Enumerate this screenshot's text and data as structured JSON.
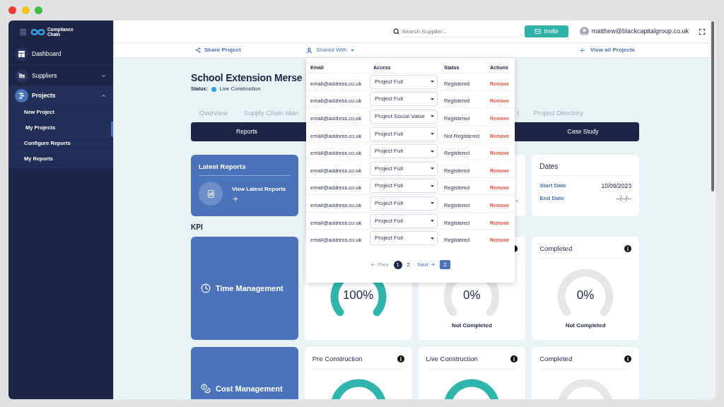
{
  "sidebar": {
    "logo_lines": [
      "Compliance",
      "Chain"
    ],
    "items": [
      {
        "label": "Dashboard",
        "kind": "link",
        "selected": false
      },
      {
        "label": "Suppliers",
        "kind": "group",
        "selected": false,
        "expanded": false
      },
      {
        "label": "Projects",
        "kind": "group",
        "selected": true,
        "expanded": true,
        "children": [
          {
            "label": "New Project",
            "selected": false
          },
          {
            "label": "My Projects",
            "selected": true
          },
          {
            "label": "Configure Reports",
            "selected": false
          },
          {
            "label": "My Reports",
            "selected": false
          }
        ]
      }
    ]
  },
  "top_bar": {
    "search": {
      "placeholder": "Search Supplier..."
    },
    "invite_button": "Invite",
    "user_email": "matthew@blackcapitalgroup.co.uk"
  },
  "project_toolbar": {
    "share_project": "Share Project",
    "shared_with": "Shared With",
    "view_all_projects": "View all Projects"
  },
  "project": {
    "title": "School Extension Merse",
    "status_label": "Status:",
    "status": "Live Construction"
  },
  "tabs": [
    {
      "label": "Overview",
      "selected": false
    },
    {
      "label": "Supply Chain Man",
      "selected": false
    },
    {
      "label": "t",
      "selected": false
    },
    {
      "label": "Project Directory",
      "selected": false
    }
  ],
  "sections": [
    {
      "label": "Reports",
      "selected": false
    },
    {
      "label": "Case Study",
      "selected": false
    }
  ],
  "latest_reports": {
    "title": "Latest Reports",
    "link": "View Latest Reports"
  },
  "summary_card": {
    "value": "-"
  },
  "dates": {
    "title": "Dates",
    "rows": [
      {
        "label": "Start Date",
        "value": "10/09/2023"
      },
      {
        "label": "End Date",
        "value": "--/--/--"
      }
    ]
  },
  "kpi": {
    "heading": "KPI",
    "rows": [
      {
        "category": "Time Management",
        "kind": "time",
        "cards": [
          {
            "info": false,
            "complete": true,
            "value": "100%"
          },
          {
            "info": true,
            "complete": false,
            "value": "0%",
            "caption": "Not Completed"
          },
          {
            "title": "Completed",
            "info": true,
            "complete": false,
            "value": "0%",
            "caption": "Not Completed"
          }
        ]
      },
      {
        "category": "Cost Management",
        "kind": "cost",
        "cards": [
          {
            "title": "Pre Construction",
            "info": true,
            "complete": true
          },
          {
            "title": "Live Construction",
            "info": true,
            "complete": true
          },
          {
            "title": "Completed",
            "info": true,
            "complete": false
          }
        ]
      }
    ]
  },
  "shared_with_popup": {
    "columns": [
      "Email",
      "Access",
      "Status",
      "Actions"
    ],
    "rows": [
      {
        "email": "email@address.co.uk",
        "access": "Project Full",
        "status": "Registered",
        "action": "Remove"
      },
      {
        "email": "email@address.co.uk",
        "access": "Project Full",
        "status": "Registered",
        "action": "Remove"
      },
      {
        "email": "email@address.co.uk",
        "access": "Project Social Value",
        "status": "Registered",
        "action": "Remove"
      },
      {
        "email": "email@address.co.uk",
        "access": "Project Full",
        "status": "Not Registered",
        "action": "Remove"
      },
      {
        "email": "email@address.co.uk",
        "access": "Project Full",
        "status": "Registered",
        "action": "Remove"
      },
      {
        "email": "email@address.co.uk",
        "access": "Project Full",
        "status": "Registered",
        "action": "Remove"
      },
      {
        "email": "email@address.co.uk",
        "access": "Project Full",
        "status": "Registered",
        "action": "Remove"
      },
      {
        "email": "email@address.co.uk",
        "access": "Project Full",
        "status": "Registered",
        "action": "Remove"
      },
      {
        "email": "email@address.co.uk",
        "access": "Project Full",
        "status": "Registered",
        "action": "Remove"
      },
      {
        "email": "email@address.co.uk",
        "access": "Project Full",
        "status": "Registered",
        "action": "Remove"
      }
    ],
    "pagination": {
      "prev": "Prev",
      "pages": [
        {
          "label": "1",
          "selected": true
        },
        {
          "label": "2",
          "selected": false
        }
      ],
      "next": "Next",
      "page_badge": "2"
    }
  }
}
